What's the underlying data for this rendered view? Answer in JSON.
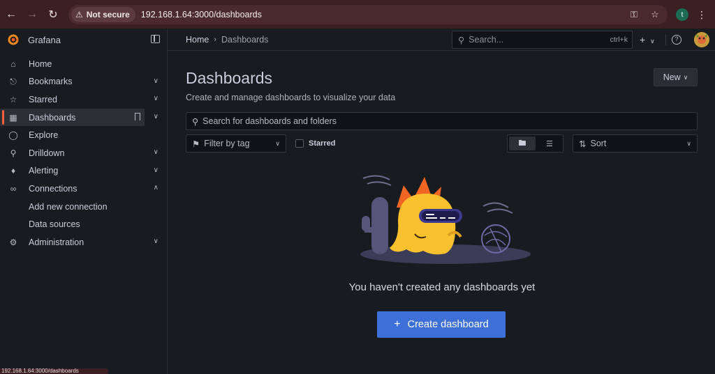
{
  "browser": {
    "security_label": "Not secure",
    "url": "192.168.1.64:3000/dashboards",
    "profile_initial": "t",
    "status_url": "192.168.1.64:3000/dashboards"
  },
  "brand": {
    "name": "Grafana"
  },
  "sidebar": {
    "items": [
      {
        "label": "Home"
      },
      {
        "label": "Bookmarks"
      },
      {
        "label": "Starred"
      },
      {
        "label": "Dashboards"
      },
      {
        "label": "Explore"
      },
      {
        "label": "Drilldown"
      },
      {
        "label": "Alerting"
      },
      {
        "label": "Connections"
      },
      {
        "label": "Add new connection"
      },
      {
        "label": "Data sources"
      },
      {
        "label": "Administration"
      }
    ]
  },
  "topbar": {
    "breadcrumb": [
      "Home",
      "Dashboards"
    ],
    "search_placeholder": "Search...",
    "search_shortcut": "ctrl+k",
    "add_label": "+",
    "help_label": "?"
  },
  "main": {
    "title": "Dashboards",
    "subtitle": "Create and manage dashboards to visualize your data",
    "new_button": "New",
    "search_placeholder": "Search for dashboards and folders",
    "filter_tag": "Filter by tag",
    "starred_label": "Starred",
    "sort_label": "Sort",
    "empty_message": "You haven't created any dashboards yet",
    "create_button": "Create dashboard"
  },
  "colors": {
    "accent": "#3d71d9",
    "active_marker": "#f55f3e",
    "background": "#181b1f"
  }
}
